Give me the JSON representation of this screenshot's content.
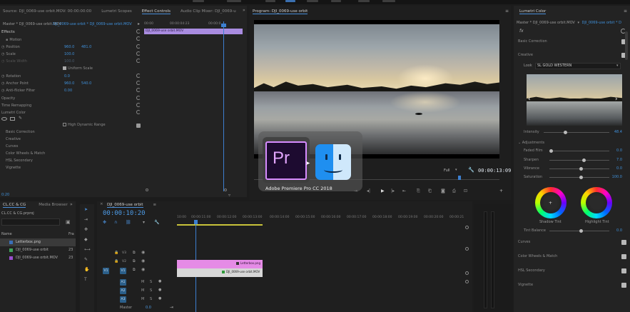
{
  "source_panel": {
    "tabs": [
      "Source: DJI_0069-use orbit.MOV: 00:00:00:00",
      "Lumetri Scopes",
      "Effect Controls",
      "Audio Clip Mixer: DJI_0069-u"
    ],
    "master_label": "Master * DJI_0069-use orbit.MOV",
    "clip_label": "DJI_0069-use orbit * DJI_0069-use orbit.MOV",
    "section": "Effects",
    "time_a": "00:00",
    "time_b": "00:00:04:23",
    "time_c": "00:00:0",
    "clip_bar": "DJI_0069-use orbit.MOV",
    "bottom_time": "0:20",
    "properties": [
      {
        "name": "Motion",
        "v1": "",
        "v2": ""
      },
      {
        "name": "Position",
        "v1": "960.0",
        "v2": "481.0"
      },
      {
        "name": "Scale",
        "v1": "100.0",
        "v2": ""
      },
      {
        "name": "Scale Width",
        "v1": "100.0",
        "v2": ""
      },
      {
        "name": "Uniform Scale",
        "v1": "",
        "v2": ""
      },
      {
        "name": "Rotation",
        "v1": "0.0",
        "v2": ""
      },
      {
        "name": "Anchor Point",
        "v1": "960.0",
        "v2": "540.0"
      },
      {
        "name": "Anti-flicker Filter",
        "v1": "0.00",
        "v2": ""
      },
      {
        "name": "Opacity",
        "v1": "",
        "v2": ""
      },
      {
        "name": "Time Remapping",
        "v1": "",
        "v2": ""
      },
      {
        "name": "Lumetri Color",
        "v1": "",
        "v2": ""
      }
    ],
    "hdr_label": "High Dynamic Range",
    "lumetri_sections": [
      "Basic Correction",
      "Creative",
      "Curves",
      "Color Wheels & Match",
      "HSL Secondary",
      "Vignette"
    ]
  },
  "program_panel": {
    "title": "Program: DJI_0069-use orbit",
    "fit": "Full",
    "timecode": "00:00:13:09"
  },
  "app_switcher": {
    "label": "Adobe Premiere Pro CC 2018",
    "pr_text": "Pr"
  },
  "project_panel": {
    "tabs": [
      "CL.CC & CG",
      "Media Browser"
    ],
    "project_name": "CL.CC & CG.prproj",
    "col_name": "Name",
    "col_fps": "Fra",
    "items": [
      {
        "name": "Letterbox.png",
        "fps": "",
        "color": "#3a6fb8"
      },
      {
        "name": "DJI_0069-use orbit",
        "fps": "23",
        "color": "#3fa35a"
      },
      {
        "name": "DJI_0069-use orbit.MOV",
        "fps": "23",
        "color": "#9a4fd0"
      }
    ]
  },
  "timeline": {
    "tab": "DJI_0069-use orbit",
    "timecode": "00:00:10:20",
    "ruler": [
      "10:00",
      "00:00:11:00",
      "00:00:12:00",
      "00:00:13:00",
      "00:00:14:00",
      "00:00:15:00",
      "00:00:16:00",
      "00:00:17:00",
      "00:00:18:00",
      "00:00:19:00",
      "00:00:20:00",
      "00:00:21"
    ],
    "video_tracks": [
      "V3",
      "V2",
      "V1"
    ],
    "audio_tracks": [
      "A1",
      "A2",
      "A3"
    ],
    "master": "Master",
    "master_val": "0.0",
    "clip_top": "Letterbox.png",
    "clip_bottom": "DJI_0069-use orbit.MOV"
  },
  "lumetri": {
    "tab": "Lumetri Color",
    "master": "Master * DJI_0069-use orbit.MOV",
    "clip": "DJI_0069-use orbit * D",
    "fx": "fx",
    "basic": "Basic Correction",
    "creative": "Creative",
    "look_label": "Look",
    "look_value": "SL GOLD WESTERN",
    "intensity_label": "Intensity",
    "intensity_value": "48.4",
    "adjustments": "Adjustments",
    "sliders": [
      {
        "label": "Faded Film",
        "value": "0.0",
        "pos": 0.0
      },
      {
        "label": "Sharpen",
        "value": "7.0",
        "pos": 0.55
      },
      {
        "label": "Vibrance",
        "value": "0.0",
        "pos": 0.5
      },
      {
        "label": "Saturation",
        "value": "100.0",
        "pos": 0.5
      }
    ],
    "shadow_tint": "Shadow Tint",
    "highlight_tint": "Highlight Tint",
    "tint_balance_label": "Tint Balance",
    "tint_balance_value": "0.0",
    "sections": [
      "Curves",
      "Color Wheels & Match",
      "HSL Secondary",
      "Vignette"
    ]
  }
}
